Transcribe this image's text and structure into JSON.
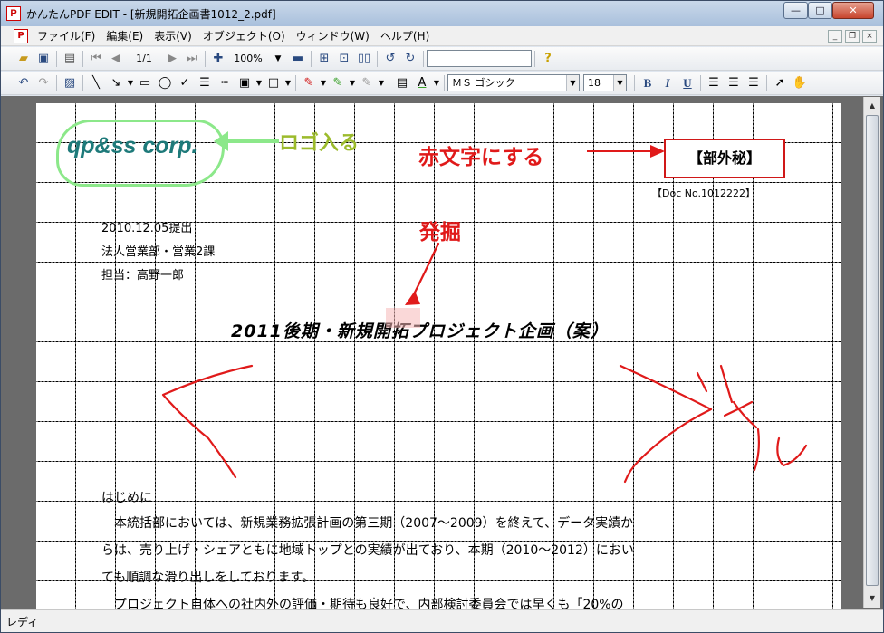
{
  "window": {
    "title": "かんたんPDF EDIT - [新規開拓企画書1012_2.pdf]",
    "app_icon_letter": "P",
    "minimize_glyph": "—",
    "maximize_glyph": "□",
    "close_glyph": "✕"
  },
  "menubar": {
    "items": [
      "ファイル(F)",
      "編集(E)",
      "表示(V)",
      "オブジェクト(O)",
      "ウィンドウ(W)",
      "ヘルプ(H)"
    ],
    "mdi_min": "_",
    "mdi_restore": "❐",
    "mdi_close": "×"
  },
  "toolbar": {
    "page_indicator": "1/1",
    "zoom": "100%",
    "search_value": "",
    "font_name": "ＭＳ ゴシック",
    "font_size": "18",
    "bold_label": "B",
    "italic_label": "I",
    "underline_label": "U"
  },
  "document": {
    "logo_text": "qp&ss corp.",
    "logo_note": "ロゴ入る",
    "red_note": "赤文字にする",
    "secret_label": "【部外秘】",
    "doc_no": "【Doc No.1012222】",
    "date_line": "2010.12.05提出",
    "dept_line": "法人営業部・営業2課",
    "person_line": "担当：高野一郎",
    "dig_note": "発掘",
    "title": "2011後期・新規開拓プロジェクト企画（案）",
    "intro_heading": "はじめに",
    "body_lines": [
      "　本統括部においては、新規業務拡張計画の第三期（2007～2009）を終えて、データ実績か",
      "らは、売り上げ・シェアともに地域トップとの実績が出ており、本期（2010～2012）におい",
      "ても順調な滑り出しをしております。",
      "　プロジェクト自体への社内外の評価・期待も良好で、内部検討委員会では早くも「20%の"
    ]
  },
  "status": {
    "text": "レディ"
  },
  "colors": {
    "annotation_red": "#e01a1a",
    "logo_green": "#8ce88a",
    "note_olive": "#9cbb2c",
    "logo_teal": "#1e7a7a"
  }
}
